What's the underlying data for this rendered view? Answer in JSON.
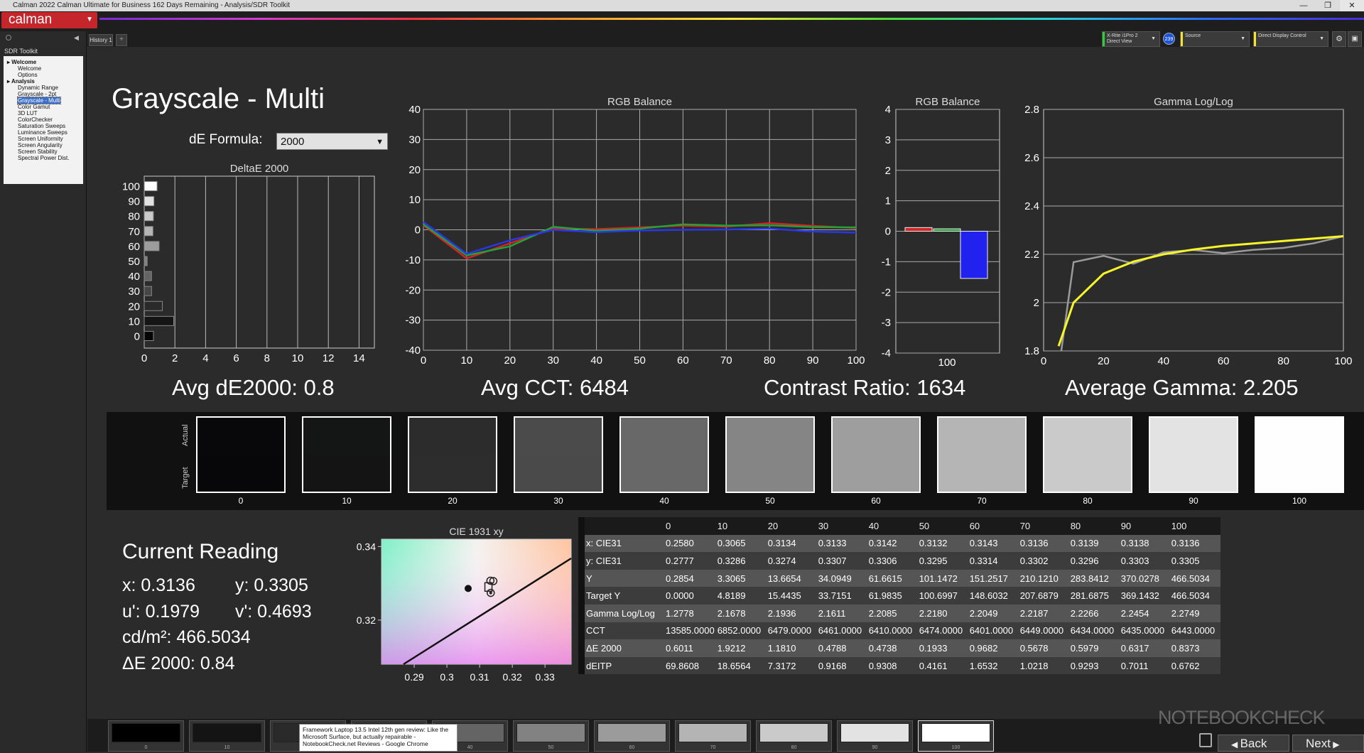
{
  "window": {
    "title": "Calman 2022 Calman Ultimate for Business 162 Days Remaining  - Analysis/SDR Toolkit"
  },
  "app": {
    "logo": "calman"
  },
  "sidebar": {
    "header": "SDR Toolkit",
    "tree": {
      "welcome_group": "Welcome",
      "welcome": "Welcome",
      "options": "Options",
      "analysis_group": "Analysis",
      "items": [
        "Dynamic Range",
        "Grayscale - 2pt",
        "Grayscale - Multi",
        "Color Gamut",
        "3D LUT",
        "ColorChecker",
        "Saturation Sweeps",
        "Luminance Sweeps",
        "Screen Uniformity",
        "Screen Angularity",
        "Screen Stability",
        "Spectral Power Dist."
      ]
    }
  },
  "tabs": {
    "history": "History 1",
    "add": "+"
  },
  "devices": {
    "meter_line1": "X-Rite i1Pro 2",
    "meter_line2": "Direct View",
    "badge": "239",
    "source": "Source",
    "display": "Direct Display Control"
  },
  "colors": {
    "accent": "#c5262b",
    "meter_bar": "#2bcf38",
    "source_bar": "#f3e52e",
    "display_bar": "#f3e52e",
    "badge": "#1f54d6",
    "gamma_curve": "#f5f52a",
    "gamma_target": "#9a9a9a",
    "swatch_border": "#ffffff"
  },
  "page": {
    "title": "Grayscale - Multi",
    "de_formula_label": "dE Formula:",
    "de_formula_value": "2000"
  },
  "stats": {
    "avg_de": "Avg dE2000: 0.8",
    "avg_cct": "Avg CCT: 6484",
    "contrast": "Contrast Ratio: 1634",
    "avg_gamma": "Average Gamma: 2.205"
  },
  "chart_data": [
    {
      "type": "bar",
      "orientation": "horizontal",
      "title": "DeltaE 2000",
      "categories": [
        "0",
        "10",
        "20",
        "30",
        "40",
        "50",
        "60",
        "70",
        "80",
        "90",
        "100"
      ],
      "values": [
        0.6011,
        1.9212,
        1.181,
        0.4788,
        0.4738,
        0.1933,
        0.9682,
        0.5678,
        0.5979,
        0.6317,
        0.8373
      ],
      "xlim": [
        0,
        15
      ],
      "xticks": [
        0,
        2,
        4,
        6,
        8,
        10,
        12,
        14
      ],
      "grid": true
    },
    {
      "type": "line",
      "title": "RGB Balance",
      "x": [
        0,
        10,
        20,
        30,
        40,
        50,
        60,
        70,
        80,
        90,
        100
      ],
      "ylim": [
        -40,
        40
      ],
      "yticks": [
        40,
        30,
        20,
        10,
        0,
        -10,
        -20,
        -30,
        -40
      ],
      "xticks": [
        0,
        10,
        20,
        30,
        40,
        50,
        60,
        70,
        80,
        90,
        100
      ],
      "series": [
        {
          "color": "#d42424",
          "values": [
            1.5,
            -9.5,
            -4.5,
            0.4,
            0.2,
            0.8,
            1.4,
            1.1,
            2.2,
            1.3,
            0.6
          ]
        },
        {
          "color": "#23a23a",
          "values": [
            1.8,
            -8.5,
            -5.5,
            1.0,
            -0.3,
            0.4,
            1.8,
            1.4,
            1.5,
            0.9,
            0.8
          ]
        },
        {
          "color": "#2a37e8",
          "values": [
            2.6,
            -8.0,
            -3.5,
            0.0,
            -0.8,
            -0.2,
            0.0,
            0.1,
            0.4,
            -0.6,
            -0.9
          ]
        }
      ],
      "grid": true
    },
    {
      "type": "bar",
      "title": "RGB Balance",
      "categories": [
        "100"
      ],
      "ylim": [
        -4,
        4
      ],
      "yticks": [
        4,
        3,
        2,
        1,
        0,
        -1,
        -2,
        -3,
        -4
      ],
      "series": [
        {
          "color": "#d42424",
          "values": [
            0.12
          ]
        },
        {
          "color": "#23a23a",
          "values": [
            0.08
          ]
        },
        {
          "color": "#2222ee",
          "values": [
            -1.55
          ]
        }
      ],
      "grid": true
    },
    {
      "type": "line",
      "title": "Gamma Log/Log",
      "x": [
        5,
        10,
        20,
        30,
        40,
        50,
        60,
        70,
        80,
        90,
        100
      ],
      "xlim": [
        0,
        100
      ],
      "ylim": [
        1.8,
        2.8
      ],
      "yticks": [
        2.8,
        2.6,
        2.4,
        2.2,
        2,
        1.8
      ],
      "xticks": [
        0,
        20,
        40,
        60,
        80,
        100
      ],
      "series": [
        {
          "color": "#f5f52a",
          "values": [
            1.82,
            2.0,
            2.12,
            2.17,
            2.2,
            2.22,
            2.235,
            2.245,
            2.255,
            2.265,
            2.275
          ]
        },
        {
          "color": "#9a9a9a",
          "values": [
            1.72,
            2.1676,
            2.1936,
            2.1611,
            2.2085,
            2.218,
            2.2049,
            2.2187,
            2.2266,
            2.2454,
            2.2749
          ]
        }
      ],
      "grid": true
    },
    {
      "type": "scatter",
      "title": "CIE 1931 xy",
      "xlim": [
        0.28,
        0.338
      ],
      "ylim": [
        0.308,
        0.342
      ],
      "xticks": [
        0.29,
        0.3,
        0.31,
        0.32,
        0.33
      ],
      "yticks": [
        0.34,
        0.32
      ],
      "points": [
        {
          "x": 0.3065,
          "y": 0.3286,
          "marker": "filled-dot"
        },
        {
          "x": 0.3134,
          "y": 0.3274,
          "marker": "target"
        },
        {
          "x": 0.3142,
          "y": 0.3306,
          "marker": "circle"
        },
        {
          "x": 0.3133,
          "y": 0.3307,
          "marker": "circle"
        },
        {
          "x": 0.3127,
          "y": 0.329,
          "marker": "square"
        }
      ]
    }
  ],
  "swatches": {
    "actual_label": "Actual",
    "target_label": "Target",
    "items": [
      {
        "label": "0",
        "actual": "#08080b",
        "target": "#07070a"
      },
      {
        "label": "10",
        "actual": "#141616",
        "target": "#141414"
      },
      {
        "label": "20",
        "actual": "#2c2c2c",
        "target": "#2d2d2d"
      },
      {
        "label": "30",
        "actual": "#4b4b4b",
        "target": "#4a4a4a"
      },
      {
        "label": "40",
        "actual": "#686868",
        "target": "#686868"
      },
      {
        "label": "50",
        "actual": "#858585",
        "target": "#858585"
      },
      {
        "label": "60",
        "actual": "#9e9e9e",
        "target": "#9e9e9e"
      },
      {
        "label": "70",
        "actual": "#b5b5b5",
        "target": "#b5b5b5"
      },
      {
        "label": "80",
        "actual": "#cacaca",
        "target": "#cacaca"
      },
      {
        "label": "90",
        "actual": "#e3e3e3",
        "target": "#e3e3e3"
      },
      {
        "label": "100",
        "actual": "#fefefe",
        "target": "#fefefe"
      }
    ]
  },
  "current_reading": {
    "title": "Current Reading",
    "x": "x: 0.3136",
    "y": "y: 0.3305",
    "u": "u': 0.1979",
    "v": "v': 0.4693",
    "cd": "cd/m²: 466.5034",
    "de": "ΔE 2000: 0.84"
  },
  "table": {
    "columns": [
      "0",
      "10",
      "20",
      "30",
      "40",
      "50",
      "60",
      "70",
      "80",
      "90",
      "100"
    ],
    "rows": [
      {
        "label": "x: CIE31",
        "cells": [
          "0.2580",
          "0.3065",
          "0.3134",
          "0.3133",
          "0.3142",
          "0.3132",
          "0.3143",
          "0.3136",
          "0.3139",
          "0.3138",
          "0.3136"
        ]
      },
      {
        "label": "y: CIE31",
        "cells": [
          "0.2777",
          "0.3286",
          "0.3274",
          "0.3307",
          "0.3306",
          "0.3295",
          "0.3314",
          "0.3302",
          "0.3296",
          "0.3303",
          "0.3305"
        ]
      },
      {
        "label": "Y",
        "cells": [
          "0.2854",
          "3.3065",
          "13.6654",
          "34.0949",
          "61.6615",
          "101.1472",
          "151.2517",
          "210.1210",
          "283.8412",
          "370.0278",
          "466.5034"
        ]
      },
      {
        "label": "Target Y",
        "cells": [
          "0.0000",
          "4.8189",
          "15.4435",
          "33.7151",
          "61.9835",
          "100.6997",
          "148.6032",
          "207.6879",
          "281.6875",
          "369.1432",
          "466.5034"
        ]
      },
      {
        "label": "Gamma Log/Log",
        "cells": [
          "1.2778",
          "2.1678",
          "2.1936",
          "2.1611",
          "2.2085",
          "2.2180",
          "2.2049",
          "2.2187",
          "2.2266",
          "2.2454",
          "2.2749"
        ]
      },
      {
        "label": "CCT",
        "cells": [
          "13585.0000",
          "6852.0000",
          "6479.0000",
          "6461.0000",
          "6410.0000",
          "6474.0000",
          "6401.0000",
          "6449.0000",
          "6434.0000",
          "6435.0000",
          "6443.0000"
        ]
      },
      {
        "label": "ΔE 2000",
        "cells": [
          "0.6011",
          "1.9212",
          "1.1810",
          "0.4788",
          "0.4738",
          "0.1933",
          "0.9682",
          "0.5678",
          "0.5979",
          "0.6317",
          "0.8373"
        ]
      },
      {
        "label": "dEITP",
        "cells": [
          "69.8608",
          "18.6564",
          "7.3172",
          "0.9168",
          "0.9308",
          "0.4161",
          "1.6532",
          "1.0218",
          "0.9293",
          "0.7011",
          "0.6762"
        ]
      }
    ]
  },
  "bottom": {
    "labels": [
      "0",
      "10",
      "20",
      "30",
      "40",
      "50",
      "60",
      "70",
      "80",
      "90",
      "100"
    ],
    "colors": [
      "#000000",
      "#141414",
      "#2a2a2a",
      "#474747",
      "#646464",
      "#828282",
      "#9b9b9b",
      "#b4b4b4",
      "#cacaca",
      "#e3e3e3",
      "#ffffff"
    ],
    "tooltip": "Framework Laptop 13.5 Intel 12th gen review: Like the Microsoft Surface, but actually repairable - NotebookCheck.net Reviews - Google Chrome",
    "back": "Back",
    "next": "Next"
  },
  "watermark": "NOTEBOOKCHECK"
}
